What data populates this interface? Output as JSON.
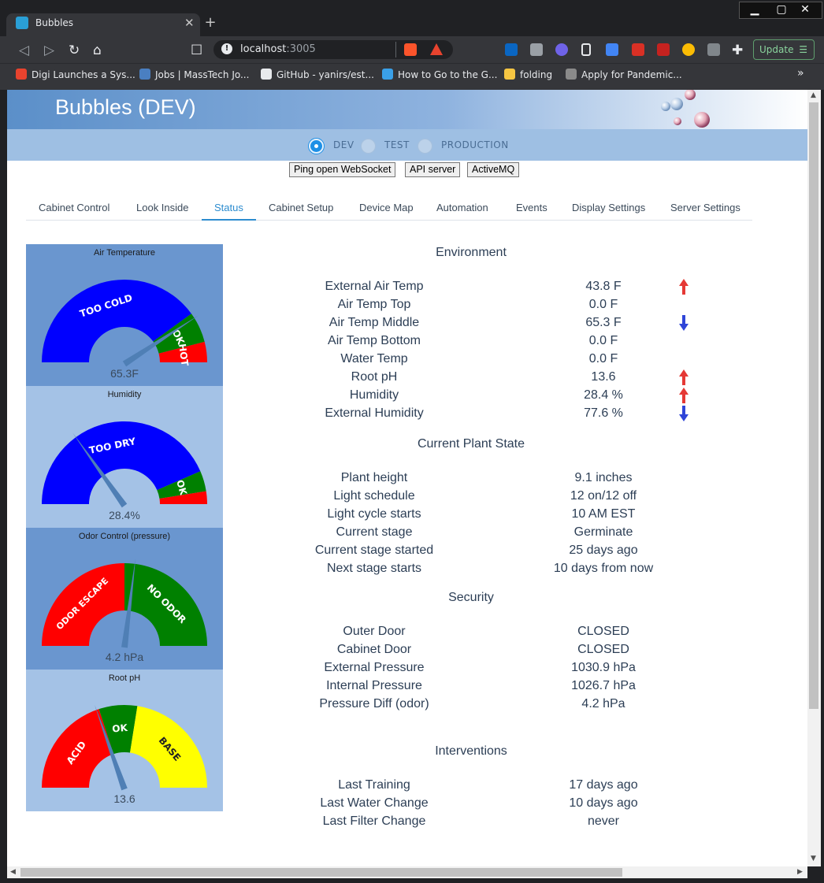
{
  "browser": {
    "tab_title": "Bubbles",
    "tab_close": "✕",
    "new_tab": "+",
    "url_host": "localhost",
    "url_port": ":3005",
    "update_label": "Update",
    "window_controls": [
      "▁",
      "▢",
      "✕"
    ],
    "bookmarks": [
      {
        "label": "Digi Launches a Sys...",
        "icon": "digi-icon",
        "color": "#e8432e"
      },
      {
        "label": "Jobs | MassTech Jo...",
        "icon": "masstech-icon",
        "color": "#4a7fc1"
      },
      {
        "label": "GitHub - yanirs/est...",
        "icon": "github-icon",
        "color": "#e8eaed"
      },
      {
        "label": "How to Go to the G...",
        "icon": "bird-icon",
        "color": "#3aa0e8"
      },
      {
        "label": "folding",
        "icon": "folder-icon",
        "color": "#f5c542"
      },
      {
        "label": "Apply for Pandemic...",
        "icon": "seal-icon",
        "color": "#8a8a8a"
      }
    ],
    "bookmarks_more": "»"
  },
  "app": {
    "title": "Bubbles (DEV)",
    "environments": [
      {
        "label": "DEV",
        "selected": true
      },
      {
        "label": "TEST",
        "selected": false
      },
      {
        "label": "PRODUCTION",
        "selected": false
      }
    ],
    "buttons": [
      "Ping open WebSocket",
      "API server",
      "ActiveMQ"
    ],
    "tabs": [
      {
        "label": "Cabinet Control",
        "active": false
      },
      {
        "label": "Look Inside",
        "active": false
      },
      {
        "label": "Status",
        "active": true
      },
      {
        "label": "Cabinet Setup",
        "active": false
      },
      {
        "label": "Device Map",
        "active": false
      },
      {
        "label": "Automation",
        "active": false
      },
      {
        "label": "Events",
        "active": false
      },
      {
        "label": "Display Settings",
        "active": false
      },
      {
        "label": "Server Settings",
        "active": false
      }
    ]
  },
  "gauges": [
    {
      "title": "Air Temperature",
      "value_label": "65.3F",
      "needle_fraction": 0.82,
      "segments": [
        {
          "label": "TOO COLD",
          "from": 0,
          "to": 0.8,
          "color": "#0000ff",
          "text_color": "#ffffff"
        },
        {
          "label": "OK",
          "from": 0.8,
          "to": 0.92,
          "color": "#008000",
          "text_color": "#ffffff"
        },
        {
          "label": "HOT",
          "from": 0.92,
          "to": 1.0,
          "color": "#ff0000",
          "text_color": "#ffffff"
        }
      ]
    },
    {
      "title": "Humidity",
      "value_label": "28.4%",
      "needle_fraction": 0.3,
      "segments": [
        {
          "label": "TOO DRY",
          "from": 0,
          "to": 0.87,
          "color": "#0000ff",
          "text_color": "#ffffff"
        },
        {
          "label": "OK",
          "from": 0.87,
          "to": 0.95,
          "color": "#008000",
          "text_color": "#ffffff"
        },
        {
          "label": "",
          "from": 0.95,
          "to": 1.0,
          "color": "#ff0000",
          "text_color": "#ffffff"
        }
      ]
    },
    {
      "title": "Odor Control (pressure)",
      "value_label": "4.2 hPa",
      "needle_fraction": 0.54,
      "segments": [
        {
          "label": "ODOR ESCAPE",
          "from": 0,
          "to": 0.5,
          "color": "#ff0000",
          "text_color": "#ffffff"
        },
        {
          "label": "NO ODOR",
          "from": 0.5,
          "to": 1.0,
          "color": "#008000",
          "text_color": "#ffffff"
        }
      ]
    },
    {
      "title": "Root pH",
      "value_label": "13.6",
      "needle_fraction": 0.39,
      "segments": [
        {
          "label": "ACID",
          "from": 0,
          "to": 0.4,
          "color": "#ff0000",
          "text_color": "#ffffff"
        },
        {
          "label": "OK",
          "from": 0.4,
          "to": 0.55,
          "color": "#008000",
          "text_color": "#ffffff"
        },
        {
          "label": "BASE",
          "from": 0.55,
          "to": 1.0,
          "color": "#ffff00",
          "text_color": "#222222"
        }
      ]
    }
  ],
  "status": {
    "sections": [
      {
        "title": "Environment",
        "rows": [
          {
            "label": "External Air Temp",
            "value": "43.8 F",
            "trend": "up"
          },
          {
            "label": "Air Temp Top",
            "value": "0.0 F",
            "trend": ""
          },
          {
            "label": "Air Temp Middle",
            "value": "65.3 F",
            "trend": "down"
          },
          {
            "label": "Air Temp Bottom",
            "value": "0.0 F",
            "trend": ""
          },
          {
            "label": "Water Temp",
            "value": "0.0 F",
            "trend": ""
          },
          {
            "label": "Root pH",
            "value": "13.6",
            "trend": "up"
          },
          {
            "label": "Humidity",
            "value": "28.4 %",
            "trend": "up"
          },
          {
            "label": "External Humidity",
            "value": "77.6 %",
            "trend": "down"
          }
        ]
      },
      {
        "title": "Current Plant State",
        "rows": [
          {
            "label": "Plant height",
            "value": "9.1 inches",
            "trend": ""
          },
          {
            "label": "Light schedule",
            "value": "12 on/12 off",
            "trend": ""
          },
          {
            "label": "Light cycle starts",
            "value": "10 AM EST",
            "trend": ""
          },
          {
            "label": "Current stage",
            "value": "Germinate",
            "trend": ""
          },
          {
            "label": "Current stage started",
            "value": "25 days ago",
            "trend": ""
          },
          {
            "label": "Next stage starts",
            "value": "10 days from now",
            "trend": ""
          }
        ]
      },
      {
        "title": "Security",
        "rows": [
          {
            "label": "Outer Door",
            "value": "CLOSED",
            "trend": ""
          },
          {
            "label": "Cabinet Door",
            "value": "CLOSED",
            "trend": ""
          },
          {
            "label": "External Pressure",
            "value": "1030.9 hPa",
            "trend": ""
          },
          {
            "label": "Internal Pressure",
            "value": "1026.7 hPa",
            "trend": ""
          },
          {
            "label": "Pressure Diff (odor)",
            "value": "4.2 hPa",
            "trend": ""
          }
        ]
      },
      {
        "title": "Interventions",
        "rows": [
          {
            "label": "Last Training",
            "value": "17 days ago",
            "trend": ""
          },
          {
            "label": "Last Water Change",
            "value": "10 days ago",
            "trend": ""
          },
          {
            "label": "Last Filter Change",
            "value": "never",
            "trend": ""
          }
        ]
      }
    ]
  },
  "colors": {
    "trend_up": "#e53935",
    "trend_down": "#2f45d8",
    "accent": "#2c8ccf",
    "needle": "#4f7fb5"
  }
}
